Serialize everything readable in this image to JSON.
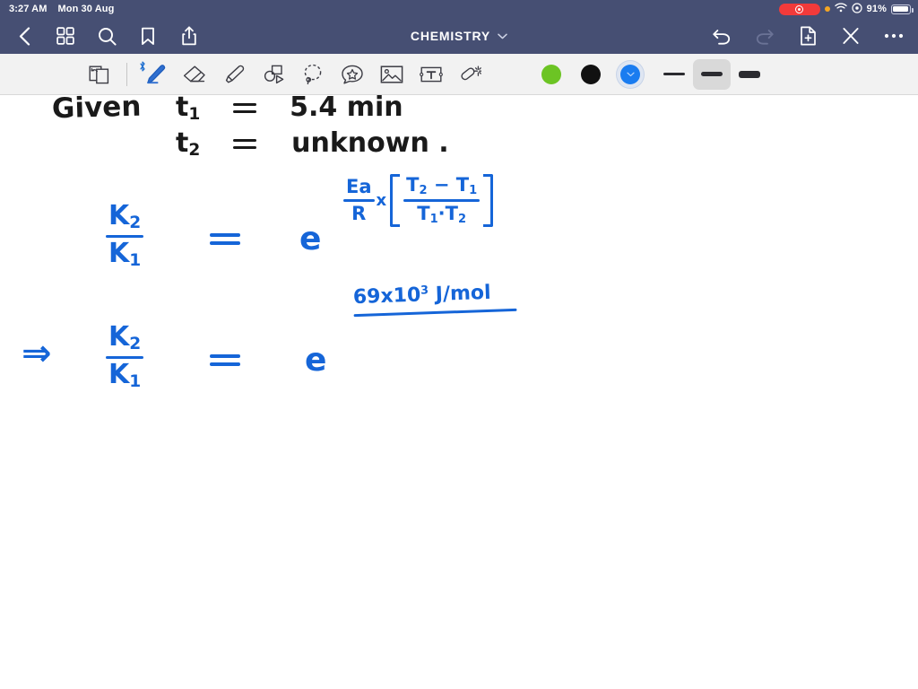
{
  "status_bar": {
    "time": "3:27 AM",
    "date": "Mon 30 Aug",
    "battery_percent": "91%",
    "icons": [
      "screen-record-pill",
      "orange-dot",
      "wifi-icon",
      "control-center-icon",
      "battery-icon"
    ]
  },
  "nav_bar": {
    "title": "CHEMISTRY",
    "title_chevron": "chevron-down-icon",
    "left_buttons": [
      {
        "name": "back-button",
        "icon": "chevron-left-icon"
      },
      {
        "name": "thumbnails-button",
        "icon": "grid-icon"
      },
      {
        "name": "search-button",
        "icon": "search-icon"
      },
      {
        "name": "bookmark-button",
        "icon": "bookmark-icon"
      },
      {
        "name": "share-button",
        "icon": "share-icon"
      }
    ],
    "right_buttons": [
      {
        "name": "undo-button",
        "icon": "undo-icon",
        "enabled": true
      },
      {
        "name": "redo-button",
        "icon": "redo-icon",
        "enabled": false
      },
      {
        "name": "add-page-button",
        "icon": "document-plus-icon",
        "enabled": true
      },
      {
        "name": "close-button",
        "icon": "close-x-icon",
        "enabled": true
      },
      {
        "name": "more-button",
        "icon": "ellipsis-icon",
        "enabled": true
      }
    ]
  },
  "toolbar": {
    "tools": [
      {
        "name": "page-flip-tool",
        "icon": "page-flip-icon",
        "active": false
      },
      {
        "name": "pen-tool",
        "icon": "pen-icon",
        "active": true,
        "badge": "bluetooth-icon"
      },
      {
        "name": "eraser-tool",
        "icon": "eraser-icon",
        "active": false
      },
      {
        "name": "highlighter-tool",
        "icon": "highlighter-icon",
        "active": false
      },
      {
        "name": "shapes-tool",
        "icon": "shapes-icon",
        "active": false
      },
      {
        "name": "lasso-tool",
        "icon": "lasso-icon",
        "active": false
      },
      {
        "name": "sticker-tool",
        "icon": "sticker-star-icon",
        "active": false
      },
      {
        "name": "image-tool",
        "icon": "image-icon",
        "active": false
      },
      {
        "name": "text-tool",
        "icon": "text-box-icon",
        "active": false
      },
      {
        "name": "magic-wand-tool",
        "icon": "magic-wand-icon",
        "active": false
      }
    ],
    "colors": [
      {
        "name": "color-green",
        "hex": "#6cc424",
        "selected": false
      },
      {
        "name": "color-black",
        "hex": "#111111",
        "selected": false
      },
      {
        "name": "color-blue",
        "hex": "#1a7cf0",
        "selected": true
      }
    ],
    "stroke_widths": [
      {
        "name": "stroke-thin",
        "thickness": 3,
        "selected": false
      },
      {
        "name": "stroke-medium",
        "thickness": 5,
        "selected": true
      },
      {
        "name": "stroke-thick",
        "thickness": 8,
        "selected": false
      }
    ]
  },
  "notes": {
    "given_label": "Given",
    "line1_var": "t",
    "line1_sub": "1",
    "line1_value": "5.4 min",
    "line2_var": "t",
    "line2_sub": "2",
    "line2_value": "unknown .",
    "eq1": {
      "lhs_num": "K",
      "lhs_num_sub": "2",
      "lhs_den": "K",
      "lhs_den_sub": "1",
      "base": "e",
      "exp_frac_num": "Ea",
      "exp_frac_den": "R",
      "times": "x",
      "bracket_num_t2": "T",
      "bracket_num_t2_sub": "2",
      "bracket_minus": "−",
      "bracket_num_t1": "T",
      "bracket_num_t1_sub": "1",
      "bracket_den_t1": "T",
      "bracket_den_t1_sub": "1",
      "bracket_dot": "·",
      "bracket_den_t2": "T",
      "bracket_den_t2_sub": "2"
    },
    "eq2": {
      "implies": "⇒",
      "lhs_num": "K",
      "lhs_num_sub": "2",
      "lhs_den": "K",
      "lhs_den_sub": "1",
      "base": "e",
      "exp_num_value": "69x10",
      "exp_num_sup": "3",
      "exp_num_unit": "J/mol"
    }
  }
}
